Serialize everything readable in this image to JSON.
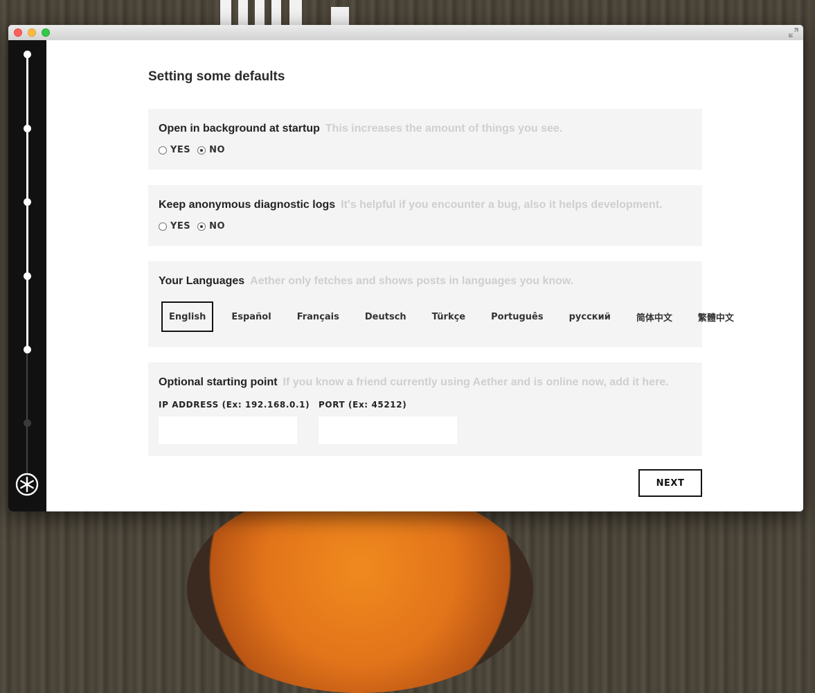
{
  "page_title": "Setting some defaults",
  "sections": {
    "background": {
      "title": "Open in background at startup",
      "hint": "This increases the amount of things you see.",
      "options": [
        "YES",
        "NO"
      ],
      "selected": "NO"
    },
    "logs": {
      "title": "Keep anonymous diagnostic logs",
      "hint": "It's helpful if you encounter a bug, also it helps development.",
      "options": [
        "YES",
        "NO"
      ],
      "selected": "NO"
    },
    "languages": {
      "title": "Your Languages",
      "hint": "Aether only fetches and shows posts in languages you know.",
      "items": [
        "English",
        "Español",
        "Français",
        "Deutsch",
        "Türkçe",
        "Português",
        "русский",
        "简体中文",
        "繁體中文"
      ],
      "selected": "English"
    },
    "starting_point": {
      "title": "Optional starting point",
      "hint": "If you know a friend currently using Aether and is online now, add it here.",
      "ip_label": "IP ADDRESS (Ex: 192.168.0.1)",
      "ip_value": "",
      "port_label": "PORT (Ex: 45212)",
      "port_value": ""
    }
  },
  "next_label": "NEXT",
  "progress": {
    "steps_total": 6,
    "steps_complete": 5
  },
  "colors": {
    "sidebar": "#111111",
    "card_bg": "#f4f4f4",
    "hint_text": "#cfcfcf"
  },
  "icons": {
    "logo": "asterisk-logo-icon",
    "fullscreen": "fullscreen-icon"
  }
}
